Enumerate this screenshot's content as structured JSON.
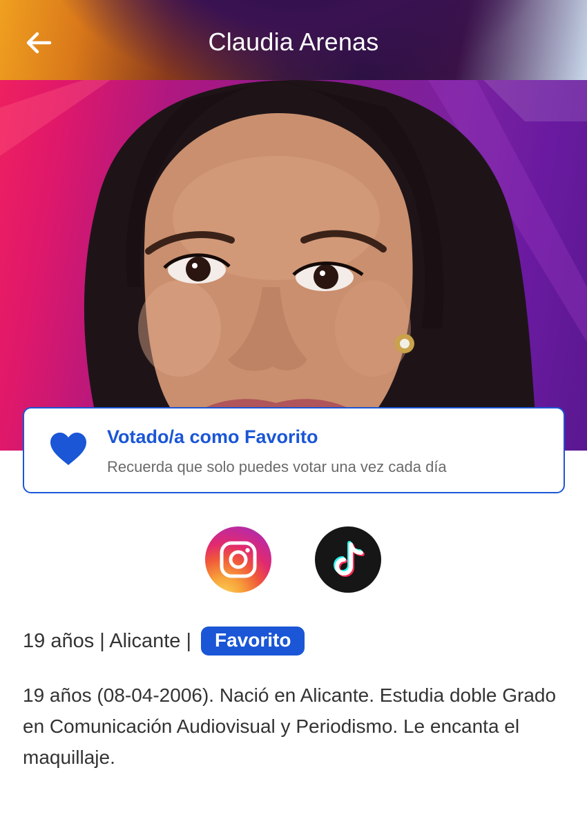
{
  "header": {
    "title": "Claudia Arenas",
    "back_icon": "arrow-left-icon"
  },
  "hero": {
    "alt": "Claudia Arenas"
  },
  "vote_card": {
    "icon": "heart-icon",
    "title": "Votado/a como Favorito",
    "subtitle": "Recuerda que solo puedes votar una vez cada día"
  },
  "social": [
    {
      "name": "instagram",
      "icon": "instagram-icon"
    },
    {
      "name": "tiktok",
      "icon": "tiktok-icon"
    }
  ],
  "profile": {
    "meta": "19 años | Alicante |",
    "badge": "Favorito",
    "bio": "19 años (08-04-2006). Nació en Alicante. Estudia doble Grado en Comunicación Audiovisual y Periodismo. Le encanta el maquillaje."
  },
  "colors": {
    "accent": "#1a56d6",
    "text": "#333333",
    "subtext": "#6a6a6a"
  }
}
